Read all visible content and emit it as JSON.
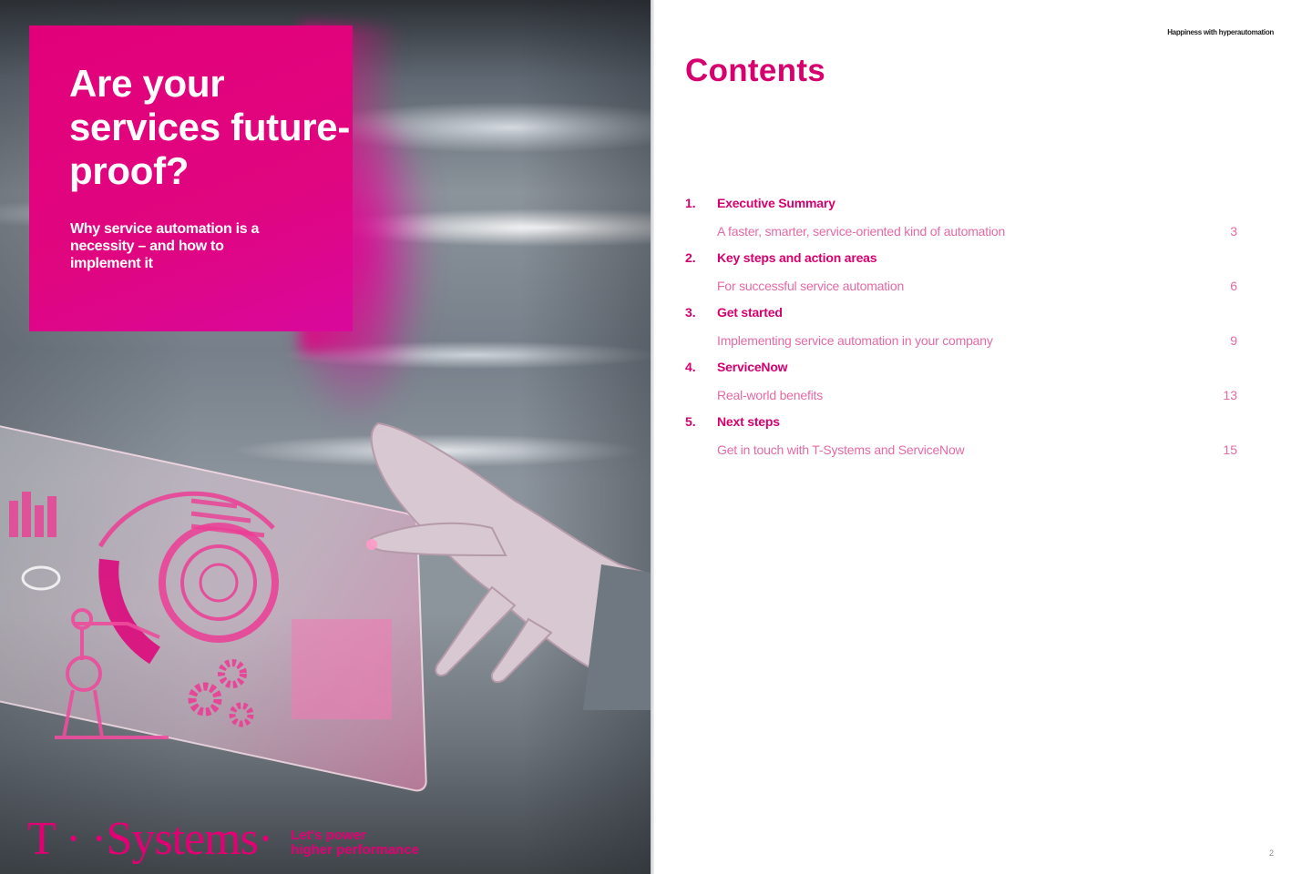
{
  "cover": {
    "title": "Are your services future-proof?",
    "subtitle": "Why service automation is a necessity – and how to implement it",
    "logo_text": "T · ·Systems·",
    "tagline_line1": "Let's power",
    "tagline_line2": "higher performance",
    "image_description": "hand touching transparent tablet with magenta automation graphics",
    "accent_color": "#e20074"
  },
  "contents_page": {
    "running_header": "Happiness with hyperautomation",
    "title": "Contents",
    "page_number": "2",
    "heading_color": "#d6006f",
    "description_color": "#e46aa6",
    "entries": [
      {
        "number": "1.",
        "heading": "Executive Summary",
        "description": "A faster, smarter, service-oriented kind of automation",
        "page": "3"
      },
      {
        "number": "2.",
        "heading": "Key steps and action areas",
        "description": "For successful service automation",
        "page": "6"
      },
      {
        "number": "3.",
        "heading": "Get started",
        "description": "Implementing service automation in your company",
        "page": "9"
      },
      {
        "number": "4.",
        "heading": "ServiceNow",
        "description": "Real-world benefits",
        "page": "13"
      },
      {
        "number": "5.",
        "heading": "Next steps",
        "description": "Get in touch with T-Systems and ServiceNow",
        "page": "15"
      }
    ]
  }
}
